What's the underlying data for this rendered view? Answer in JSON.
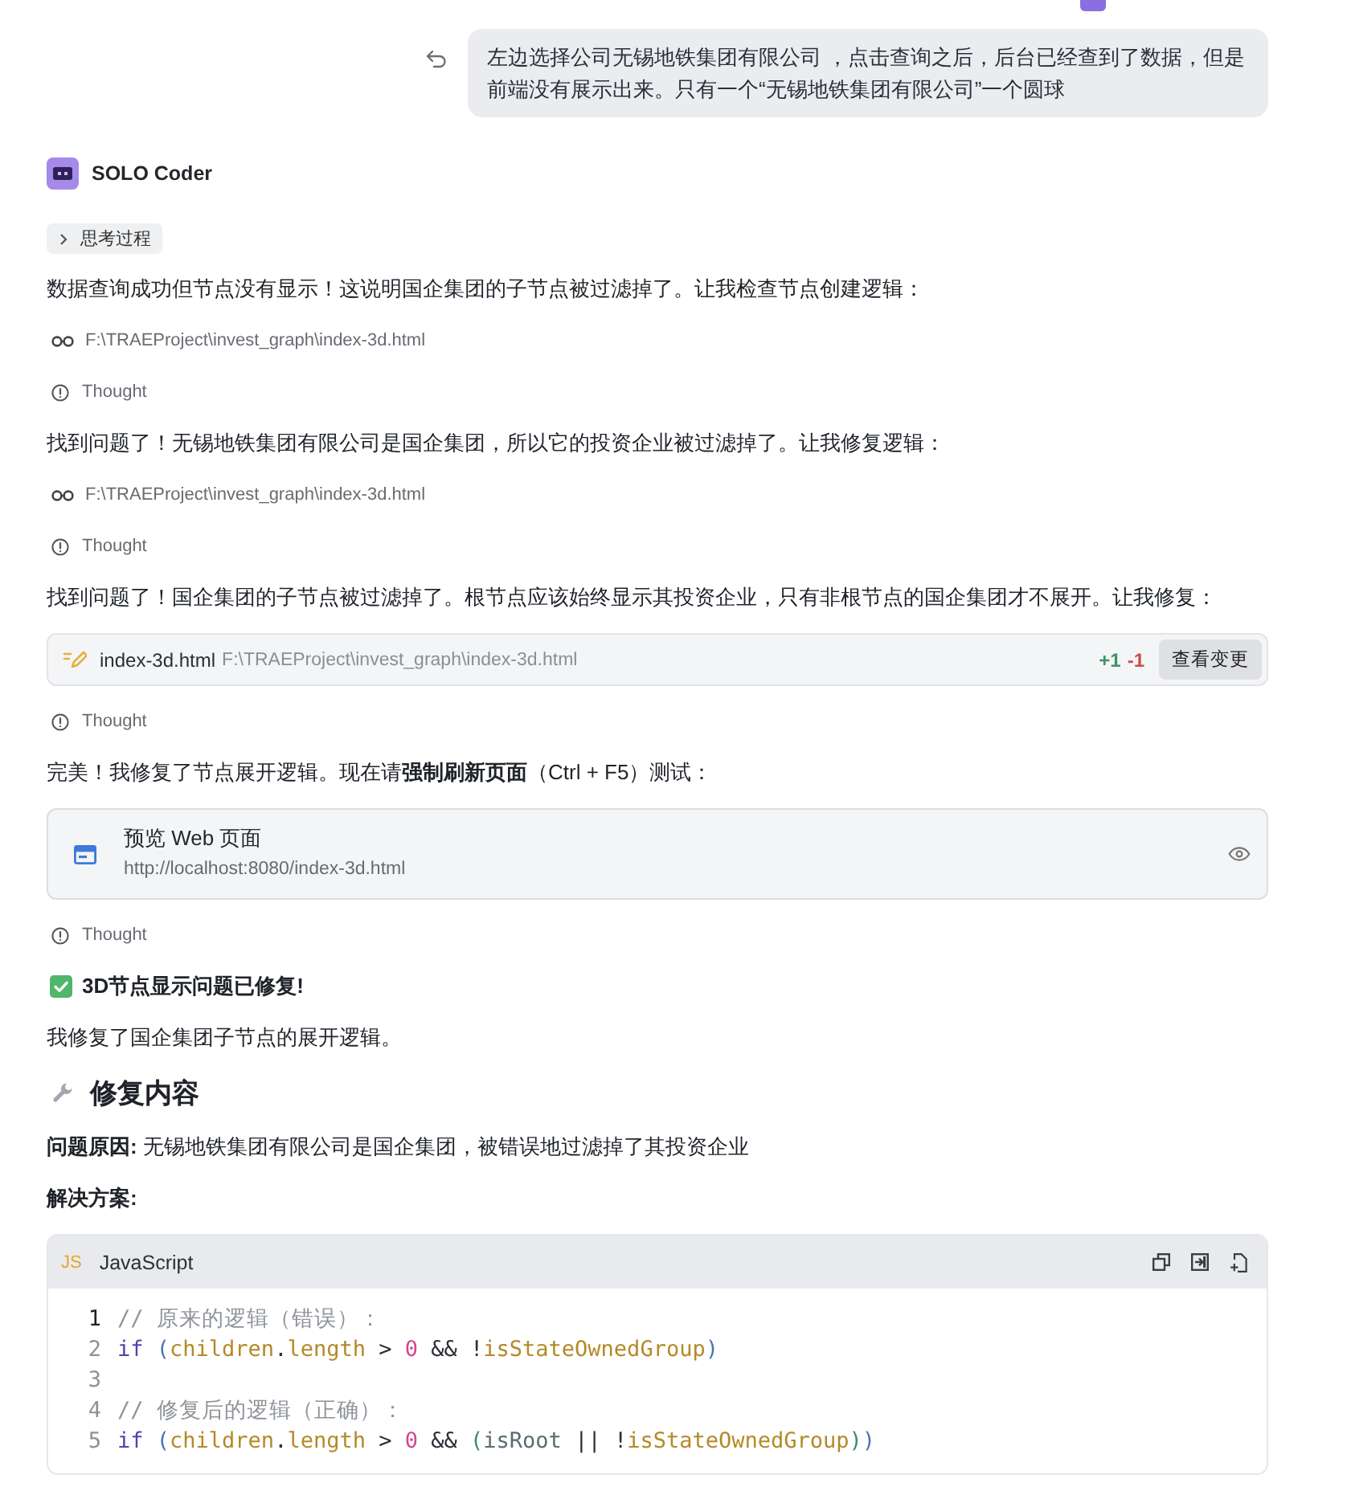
{
  "user_message": {
    "text": "左边选择公司无锡地铁集团有限公司 ，点击查询之后，后台已经查到了数据，但是前端没有展示出来。只有一个“无锡地铁集团有限公司”一个圆球"
  },
  "agent": {
    "name": "SOLO Coder"
  },
  "blocks": [
    {
      "kind": "thinking_toggle",
      "label": "思考过程",
      "expanded": false
    },
    {
      "kind": "paragraph",
      "text": "数据查询成功但节点没有显示！这说明国企集团的子节点被过滤掉了。让我检查节点创建逻辑："
    },
    {
      "kind": "file_read",
      "path": "F:\\TRAEProject\\invest_graph\\index-3d.html"
    },
    {
      "kind": "thought",
      "label": "Thought"
    },
    {
      "kind": "paragraph",
      "text": "找到问题了！无锡地铁集团有限公司是国企集团，所以它的投资企业被过滤掉了。让我修复逻辑："
    },
    {
      "kind": "file_read",
      "path": "F:\\TRAEProject\\invest_graph\\index-3d.html"
    },
    {
      "kind": "thought",
      "label": "Thought"
    },
    {
      "kind": "paragraph",
      "text": "找到问题了！国企集团的子节点被过滤掉了。根节点应该始终显示其投资企业，只有非根节点的国企集团才不展开。让我修复："
    },
    {
      "kind": "file_edit",
      "file": "index-3d.html",
      "path": "F:\\TRAEProject\\invest_graph\\index-3d.html",
      "added": "+1",
      "removed": "-1",
      "button": "查看变更"
    },
    {
      "kind": "thought",
      "label": "Thought"
    },
    {
      "kind": "paragraph",
      "text": "完美！我修复了节点展开逻辑。现在请**强制刷新页面**（Ctrl + F5）测试："
    },
    {
      "kind": "preview",
      "title": "预览 Web 页面",
      "url": "http://localhost:8080/index-3d.html"
    },
    {
      "kind": "thought",
      "label": "Thought"
    },
    {
      "kind": "done_heading",
      "text": "3D节点显示问题已修复!"
    },
    {
      "kind": "paragraph",
      "text": "我修复了国企集团子节点的展开逻辑。"
    },
    {
      "kind": "section_heading",
      "text": "修复内容"
    },
    {
      "kind": "paragraph",
      "text": "**问题原因:** 无锡地铁集团有限公司是国企集团，被错误地过滤掉了其投资企业"
    },
    {
      "kind": "bold_paragraph",
      "text": "解决方案:"
    },
    {
      "kind": "code",
      "badge": "JS",
      "language": "JavaScript",
      "lines": [
        {
          "number": "1",
          "current": true,
          "tokens": [
            {
              "kind": "comment",
              "text": "// 原来的逻辑（错误）："
            }
          ]
        },
        {
          "number": "2",
          "current": false,
          "tokens": [
            {
              "kind": "keyword",
              "text": "if"
            },
            {
              "kind": "bracket",
              "text": " ("
            },
            {
              "kind": "property",
              "text": "children"
            },
            {
              "kind": "op",
              "text": "."
            },
            {
              "kind": "property",
              "text": "length"
            },
            {
              "kind": "op",
              "text": " > "
            },
            {
              "kind": "number",
              "text": "0"
            },
            {
              "kind": "op",
              "text": " && !"
            },
            {
              "kind": "property",
              "text": "isStateOwnedGroup"
            },
            {
              "kind": "bracket",
              "text": ")"
            }
          ]
        },
        {
          "number": "3",
          "current": false
        },
        {
          "number": "4",
          "current": false,
          "tokens": [
            {
              "kind": "comment",
              "text": "// 修复后的逻辑（正确）："
            }
          ]
        },
        {
          "number": "5",
          "current": false,
          "tokens": [
            {
              "kind": "keyword",
              "text": "if"
            },
            {
              "kind": "bracket",
              "text": " ("
            },
            {
              "kind": "property",
              "text": "children"
            },
            {
              "kind": "op",
              "text": "."
            },
            {
              "kind": "property",
              "text": "length"
            },
            {
              "kind": "op",
              "text": " > "
            },
            {
              "kind": "number",
              "text": "0"
            },
            {
              "kind": "op",
              "text": " && "
            },
            {
              "kind": "bracket2",
              "text": "("
            },
            {
              "kind": "variable",
              "text": "isRoot"
            },
            {
              "kind": "op",
              "text": " || !"
            },
            {
              "kind": "property",
              "text": "isStateOwnedGroup"
            },
            {
              "kind": "bracket2",
              "text": ")"
            },
            {
              "kind": "bracket",
              "text": ")"
            }
          ]
        }
      ]
    }
  ]
}
